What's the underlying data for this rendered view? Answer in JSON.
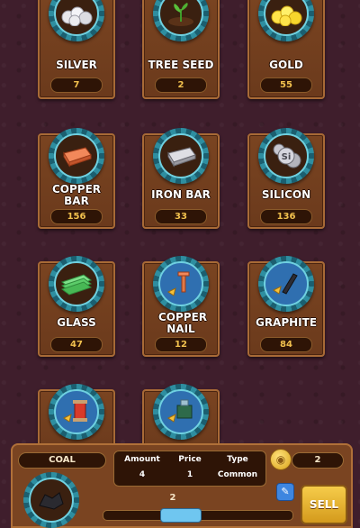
{
  "items": [
    {
      "name": "SILVER",
      "qty": "7",
      "icon": "silver-nuggets-icon"
    },
    {
      "name": "TREE SEED",
      "qty": "2",
      "icon": "tree-seed-sprout-icon"
    },
    {
      "name": "GOLD",
      "qty": "55",
      "icon": "gold-nuggets-icon"
    },
    {
      "name": "COPPER BAR",
      "qty": "156",
      "icon": "copper-bar-icon"
    },
    {
      "name": "IRON BAR",
      "qty": "33",
      "icon": "iron-bar-icon"
    },
    {
      "name": "SILICON",
      "qty": "136",
      "icon": "silicon-icon"
    },
    {
      "name": "GLASS",
      "qty": "47",
      "icon": "glass-sheet-icon"
    },
    {
      "name": "COPPER NAIL",
      "qty": "12",
      "icon": "copper-nail-blueprint-icon"
    },
    {
      "name": "GRAPHITE",
      "qty": "84",
      "icon": "graphite-blueprint-icon"
    },
    {
      "name": "",
      "qty": "",
      "icon": "spool-blueprint-icon"
    },
    {
      "name": "",
      "qty": "",
      "icon": "circuit-blueprint-icon"
    }
  ],
  "detail": {
    "selected_name": "COAL",
    "amount_label": "Amount",
    "amount_value": "4",
    "price_label": "Price",
    "price_value": "1",
    "type_label": "Type",
    "type_value": "Common",
    "coin_count": "2",
    "sell_quantity": "2",
    "sell_label": "SELL",
    "selected_icon": "coal-icon"
  },
  "colors": {
    "background": "#3f1e2c",
    "card": "#7a4421",
    "accent_gold": "#f2c14e",
    "gear_teal": "#2e8ea0"
  }
}
